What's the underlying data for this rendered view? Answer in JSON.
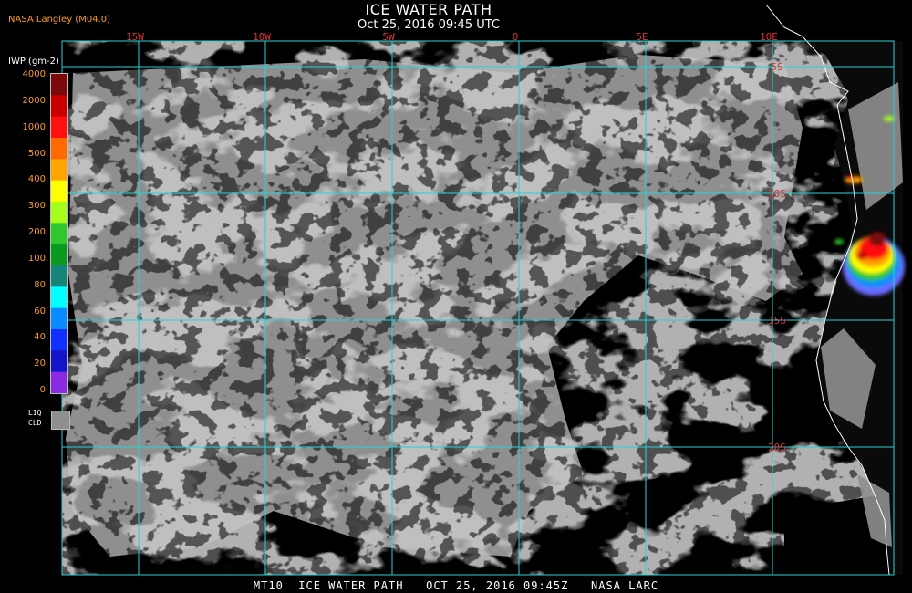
{
  "header": {
    "title": "ICE WATER PATH",
    "subtitle": "Oct 25, 2016 09:45 UTC",
    "source": "NASA Langley (M04.0)"
  },
  "legend": {
    "unit_label": "IWP (gm-2)",
    "ticks": [
      "4000",
      "2000",
      "1000",
      "500",
      "400",
      "300",
      "200",
      "100",
      "80",
      "60",
      "40",
      "20",
      "0"
    ],
    "colors": [
      "#7a0a0a",
      "#c80000",
      "#ff1010",
      "#ff6a00",
      "#ffa500",
      "#ffff00",
      "#a6ff1a",
      "#2ec82e",
      "#0a9a1e",
      "#15857a",
      "#00ffff",
      "#0a8cff",
      "#1030ff",
      "#1414c8",
      "#8a2be2"
    ],
    "liquid_label_line1": "LIQ",
    "liquid_label_line2": "CLD",
    "liquid_color": "#8f8f8f"
  },
  "map": {
    "longitude_labels": [
      "15W",
      "10W",
      "5W",
      "0",
      "5E",
      "10E"
    ],
    "latitude_labels": [
      "5S",
      "10S",
      "15S",
      "20S"
    ],
    "grid_color": "#27d3d3",
    "label_color": "#e23030",
    "coast_color": "#ffffff",
    "ocean_color": "#000000"
  },
  "footer": {
    "text": "MT10  ICE WATER PATH   OCT 25, 2016 09:45Z   NASA LARC"
  }
}
